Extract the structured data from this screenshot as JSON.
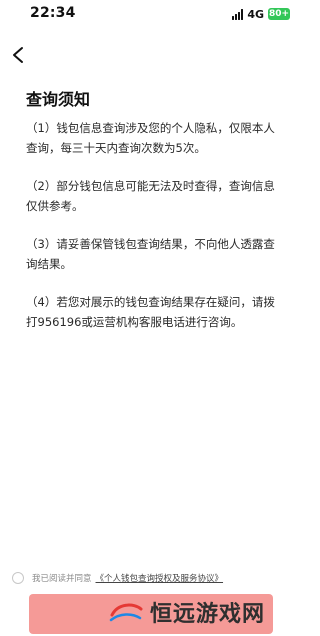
{
  "status_bar": {
    "time": "22:34",
    "network": "4G",
    "battery": "80+",
    "battery_color": "#34c759"
  },
  "nav": {
    "back_icon": "chevron-left-icon"
  },
  "notice": {
    "title": "查询须知",
    "items": [
      "（1）钱包信息查询涉及您的个人隐私，仅限本人查询，每三十天内查询次数为5次。",
      "（2）部分钱包信息可能无法及时查得，查询信息仅供参考。",
      "（3）请妥善保管钱包查询结果，不向他人透露查询结果。",
      "（4）若您对展示的钱包查询结果存在疑问，请拨打956196或运营机构客服电话进行咨询。"
    ]
  },
  "agreement": {
    "prefix": "我已阅读并同意",
    "link": "《个人钱包查询授权及服务协议》"
  },
  "button": {
    "color": "#f59a97"
  },
  "watermark": {
    "text": "恒远游戏网"
  }
}
